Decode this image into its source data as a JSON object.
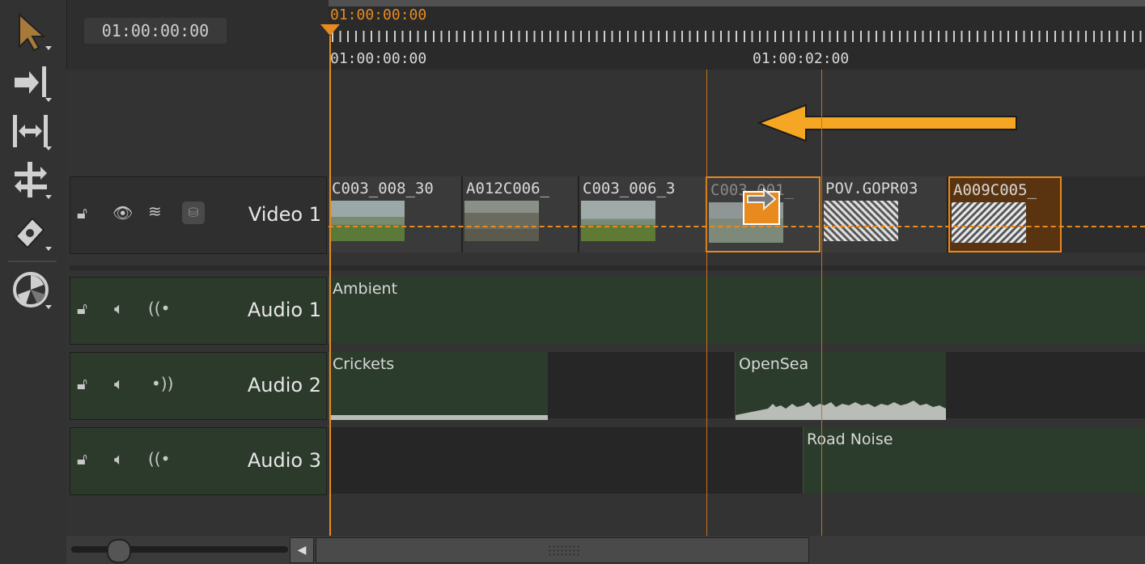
{
  "timecode": {
    "current": "01:00:00:00"
  },
  "ruler": {
    "playhead_label": "01:00:00:00",
    "start_label": "01:00:00:00",
    "mark_label": "01:00:02:00"
  },
  "toolbar": {
    "tools": [
      "select-tool",
      "track-forward-tool",
      "ripple-tool",
      "slip-tool",
      "razor-tool",
      "color-wheel-tool"
    ]
  },
  "tracks": {
    "video1": {
      "name": "Video 1",
      "clips": [
        "C003_008_30",
        "A012C006_",
        "C003_006_3",
        "C003_001_",
        "POV.GOPR03",
        "A009C005_"
      ]
    },
    "audio1": {
      "name": "Audio 1",
      "clips": [
        "Ambient"
      ]
    },
    "audio2": {
      "name": "Audio 2",
      "clips": [
        "Crickets",
        "OpenSea"
      ]
    },
    "audio3": {
      "name": "Audio 3",
      "clips": [
        "Road Noise"
      ]
    }
  },
  "colors": {
    "accent": "#e88a1e",
    "arrow": "#f5a623",
    "audio_clip": "#2c3c2c"
  }
}
